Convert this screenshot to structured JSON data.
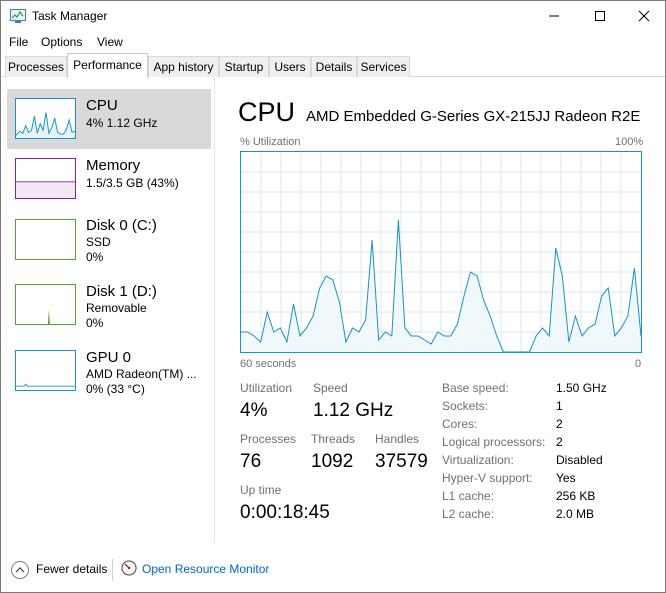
{
  "window": {
    "title": "Task Manager"
  },
  "menu": [
    "File",
    "Options",
    "View"
  ],
  "tabs": [
    "Processes",
    "Performance",
    "App history",
    "Startup",
    "Users",
    "Details",
    "Services"
  ],
  "active_tab": "Performance",
  "resources": [
    {
      "name": "CPU",
      "sub1": "4%  1.12 GHz",
      "sub2": "",
      "color": "#1992c6"
    },
    {
      "name": "Memory",
      "sub1": "1.5/3.5 GB (43%)",
      "sub2": "",
      "color": "#8b1ea7"
    },
    {
      "name": "Disk 0 (C:)",
      "sub1": "SSD",
      "sub2": "0%",
      "color": "#4ea52d"
    },
    {
      "name": "Disk 1 (D:)",
      "sub1": "Removable",
      "sub2": "0%",
      "color": "#4ea52d"
    },
    {
      "name": "GPU 0",
      "sub1": "AMD Radeon(TM) ...",
      "sub2": "0%  (33 °C)",
      "color": "#1992c6"
    }
  ],
  "main": {
    "title": "CPU",
    "subtitle": "AMD Embedded G-Series GX-215JJ Radeon R2E",
    "graph_label": "% Utilization",
    "graph_max": "100%",
    "time_label": "60 seconds",
    "time_end": "0"
  },
  "chart_data": {
    "type": "area",
    "title": "",
    "ylabel": "% Utilization",
    "ylim": [
      0,
      100
    ],
    "xlabel": "60 seconds",
    "x_range": [
      60,
      0
    ],
    "series": [
      {
        "values": [
          10,
          10,
          8,
          5,
          20,
          10,
          12,
          5,
          24,
          8,
          12,
          18,
          32,
          38,
          36,
          25,
          5,
          12,
          10,
          16,
          56,
          6,
          10,
          8,
          66,
          12,
          8,
          8,
          6,
          4,
          10,
          8,
          8,
          14,
          28,
          40,
          38,
          26,
          18,
          8,
          0,
          0,
          0,
          0,
          0,
          8,
          12,
          8,
          52,
          38,
          5,
          18,
          8,
          12,
          14,
          28,
          32,
          8,
          12,
          18,
          42,
          8
        ]
      }
    ]
  },
  "stats": {
    "utilization": {
      "label": "Utilization",
      "value": "4%"
    },
    "speed": {
      "label": "Speed",
      "value": "1.12 GHz"
    },
    "processes": {
      "label": "Processes",
      "value": "76"
    },
    "threads": {
      "label": "Threads",
      "value": "1092"
    },
    "handles": {
      "label": "Handles",
      "value": "37579"
    },
    "uptime": {
      "label": "Up time",
      "value": "0:00:18:45"
    }
  },
  "specs": [
    {
      "label": "Base speed:",
      "value": "1.50 GHz"
    },
    {
      "label": "Sockets:",
      "value": "1"
    },
    {
      "label": "Cores:",
      "value": "2"
    },
    {
      "label": "Logical processors:",
      "value": "2"
    },
    {
      "label": "Virtualization:",
      "value": "Disabled"
    },
    {
      "label": "Hyper-V support:",
      "value": "Yes"
    },
    {
      "label": "L1 cache:",
      "value": "256 KB"
    },
    {
      "label": "L2 cache:",
      "value": "2.0 MB"
    }
  ],
  "footer": {
    "fewer_details": "Fewer details",
    "open_resource_monitor": "Open Resource Monitor"
  }
}
